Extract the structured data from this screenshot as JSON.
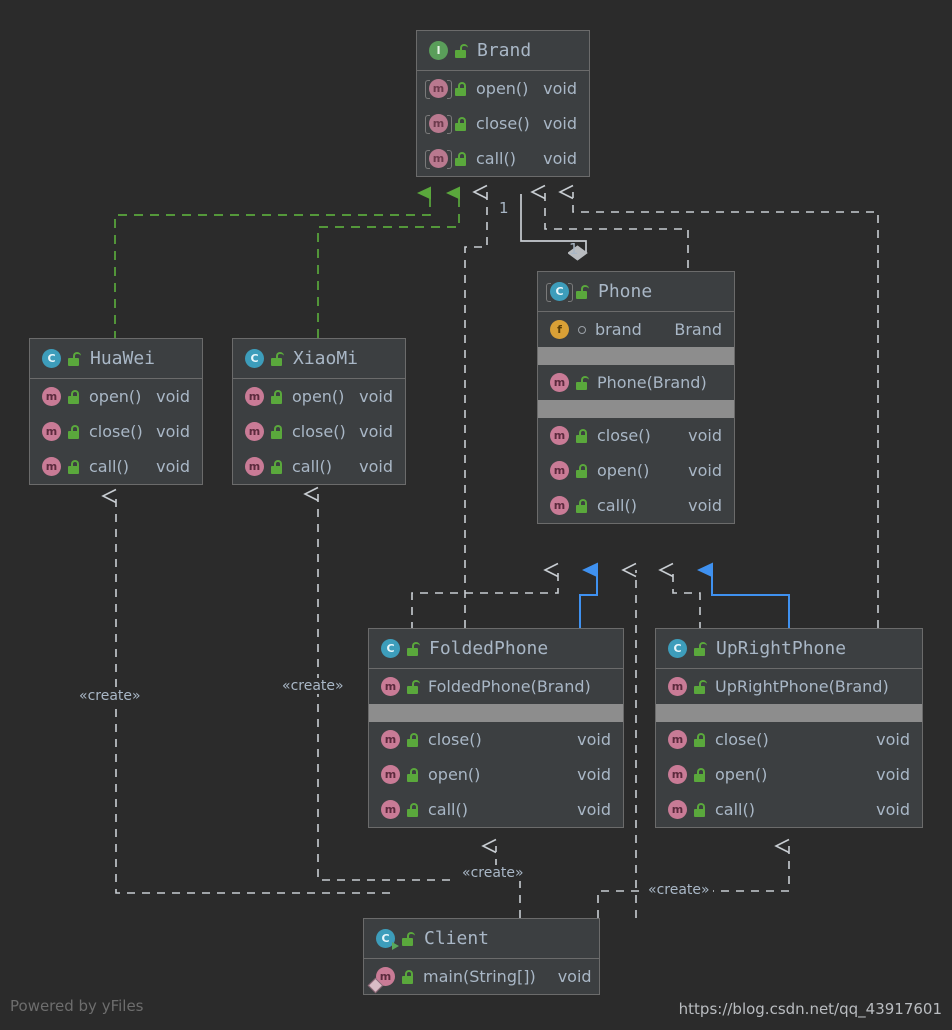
{
  "diagram": {
    "type": "uml-class-diagram",
    "background_color": "#2b2b2b",
    "nodes": [
      {
        "id": "brand",
        "name": "Brand",
        "stereotype": "interface",
        "icon": "interface-icon",
        "visibility_icon": "unlocked-padlock-icon",
        "members": [
          {
            "icon": "abstract-method-icon",
            "lock": "unlocked-padlock-icon",
            "name": "open()",
            "type": "void"
          },
          {
            "icon": "abstract-method-icon",
            "lock": "unlocked-padlock-icon",
            "name": "close()",
            "type": "void"
          },
          {
            "icon": "abstract-method-icon",
            "lock": "unlocked-padlock-icon",
            "name": "call()",
            "type": "void"
          }
        ]
      },
      {
        "id": "huawei",
        "name": "HuaWei",
        "stereotype": "class",
        "icon": "class-icon",
        "visibility_icon": "unlocked-padlock-icon",
        "members": [
          {
            "icon": "method-icon",
            "lock": "unlocked-padlock-icon",
            "name": "open()",
            "type": "void"
          },
          {
            "icon": "method-icon",
            "lock": "unlocked-padlock-icon",
            "name": "close()",
            "type": "void"
          },
          {
            "icon": "method-icon",
            "lock": "unlocked-padlock-icon",
            "name": "call()",
            "type": "void"
          }
        ]
      },
      {
        "id": "xiaomi",
        "name": "XiaoMi",
        "stereotype": "class",
        "icon": "class-icon",
        "visibility_icon": "unlocked-padlock-icon",
        "members": [
          {
            "icon": "method-icon",
            "lock": "unlocked-padlock-icon",
            "name": "open()",
            "type": "void"
          },
          {
            "icon": "method-icon",
            "lock": "unlocked-padlock-icon",
            "name": "close()",
            "type": "void"
          },
          {
            "icon": "method-icon",
            "lock": "unlocked-padlock-icon",
            "name": "call()",
            "type": "void"
          }
        ]
      },
      {
        "id": "phone",
        "name": "Phone",
        "stereotype": "abstract-class",
        "icon": "class-icon",
        "visibility_icon": "unlocked-padlock-icon",
        "members": [
          {
            "icon": "field-icon",
            "lock": "protected-dot-icon",
            "name": "brand",
            "type": "Brand"
          },
          {
            "separator": true
          },
          {
            "icon": "method-icon",
            "lock": "unlocked-padlock-icon",
            "name": "Phone(Brand)",
            "type": ""
          },
          {
            "separator": true
          },
          {
            "icon": "method-icon",
            "lock": "unlocked-padlock-icon",
            "name": "close()",
            "type": "void"
          },
          {
            "icon": "method-icon",
            "lock": "unlocked-padlock-icon",
            "name": "open()",
            "type": "void"
          },
          {
            "icon": "method-icon",
            "lock": "unlocked-padlock-icon",
            "name": "call()",
            "type": "void"
          }
        ]
      },
      {
        "id": "foldedphone",
        "name": "FoldedPhone",
        "stereotype": "class",
        "icon": "class-icon",
        "visibility_icon": "unlocked-padlock-icon",
        "members": [
          {
            "icon": "method-icon",
            "lock": "unlocked-padlock-icon",
            "name": "FoldedPhone(Brand)",
            "type": ""
          },
          {
            "separator": true
          },
          {
            "icon": "method-icon",
            "lock": "unlocked-padlock-icon",
            "name": "close()",
            "type": "void"
          },
          {
            "icon": "method-icon",
            "lock": "unlocked-padlock-icon",
            "name": "open()",
            "type": "void"
          },
          {
            "icon": "method-icon",
            "lock": "unlocked-padlock-icon",
            "name": "call()",
            "type": "void"
          }
        ]
      },
      {
        "id": "uprightphone",
        "name": "UpRightPhone",
        "stereotype": "class",
        "icon": "class-icon",
        "visibility_icon": "unlocked-padlock-icon",
        "members": [
          {
            "icon": "method-icon",
            "lock": "unlocked-padlock-icon",
            "name": "UpRightPhone(Brand)",
            "type": ""
          },
          {
            "separator": true
          },
          {
            "icon": "method-icon",
            "lock": "unlocked-padlock-icon",
            "name": "close()",
            "type": "void"
          },
          {
            "icon": "method-icon",
            "lock": "unlocked-padlock-icon",
            "name": "open()",
            "type": "void"
          },
          {
            "icon": "method-icon",
            "lock": "unlocked-padlock-icon",
            "name": "call()",
            "type": "void"
          }
        ]
      },
      {
        "id": "client",
        "name": "Client",
        "stereotype": "runnable-class",
        "icon": "runnable-class-icon",
        "visibility_icon": "unlocked-padlock-icon",
        "members": [
          {
            "icon": "main-method-icon",
            "lock": "unlocked-padlock-icon",
            "name": "main(String[])",
            "type": "void"
          }
        ]
      }
    ],
    "edges": [
      {
        "from": "huawei",
        "to": "brand",
        "kind": "realization",
        "color": "#5aa83c",
        "style": "dashed",
        "arrow": "closed-filled-triangle"
      },
      {
        "from": "xiaomi",
        "to": "brand",
        "kind": "realization",
        "color": "#5aa83c",
        "style": "dashed",
        "arrow": "closed-filled-triangle"
      },
      {
        "from": "phone",
        "to": "brand",
        "kind": "aggregation",
        "color": "#c8cdd2",
        "style": "solid",
        "arrow": "hollow-diamond",
        "source_multiplicity": "1",
        "target_multiplicity": "1"
      },
      {
        "from": "phone",
        "to": "brand",
        "kind": "dependency",
        "color": "#c8cdd2",
        "style": "dashed",
        "arrow": "open-arrow"
      },
      {
        "from": "foldedphone",
        "to": "brand",
        "kind": "dependency",
        "color": "#c8cdd2",
        "style": "dashed",
        "arrow": "open-arrow"
      },
      {
        "from": "uprightphone",
        "to": "brand",
        "kind": "dependency",
        "color": "#c8cdd2",
        "style": "dashed",
        "arrow": "open-arrow"
      },
      {
        "from": "foldedphone",
        "to": "phone",
        "kind": "generalization",
        "color": "#3f91f0",
        "style": "solid",
        "arrow": "closed-filled-triangle"
      },
      {
        "from": "uprightphone",
        "to": "phone",
        "kind": "generalization",
        "color": "#3f91f0",
        "style": "solid",
        "arrow": "closed-filled-triangle"
      },
      {
        "from": "foldedphone",
        "to": "phone",
        "kind": "dependency",
        "color": "#c8cdd2",
        "style": "dashed",
        "arrow": "open-arrow"
      },
      {
        "from": "uprightphone",
        "to": "phone",
        "kind": "dependency",
        "color": "#c8cdd2",
        "style": "dashed",
        "arrow": "open-arrow"
      },
      {
        "from": "client",
        "to": "phone",
        "kind": "dependency",
        "color": "#c8cdd2",
        "style": "dashed",
        "arrow": "open-arrow"
      },
      {
        "from": "client",
        "to": "huawei",
        "kind": "dependency",
        "color": "#c8cdd2",
        "style": "dashed",
        "arrow": "open-arrow",
        "label": "«create»"
      },
      {
        "from": "client",
        "to": "xiaomi",
        "kind": "dependency",
        "color": "#c8cdd2",
        "style": "dashed",
        "arrow": "open-arrow",
        "label": "«create»"
      },
      {
        "from": "client",
        "to": "foldedphone",
        "kind": "dependency",
        "color": "#c8cdd2",
        "style": "dashed",
        "arrow": "open-arrow",
        "label": "«create»"
      },
      {
        "from": "client",
        "to": "uprightphone",
        "kind": "dependency",
        "color": "#c8cdd2",
        "style": "dashed",
        "arrow": "open-arrow",
        "label": "«create»"
      }
    ],
    "labels": {
      "create_1": "«create»",
      "create_2": "«create»",
      "create_3": "«create»",
      "create_4": "«create»",
      "mult_phone_top": "1",
      "mult_phone_bottom": "1"
    }
  },
  "footer": {
    "powered_by": "Powered by yFiles",
    "watermark": "https://blog.csdn.net/qq_43917601"
  }
}
